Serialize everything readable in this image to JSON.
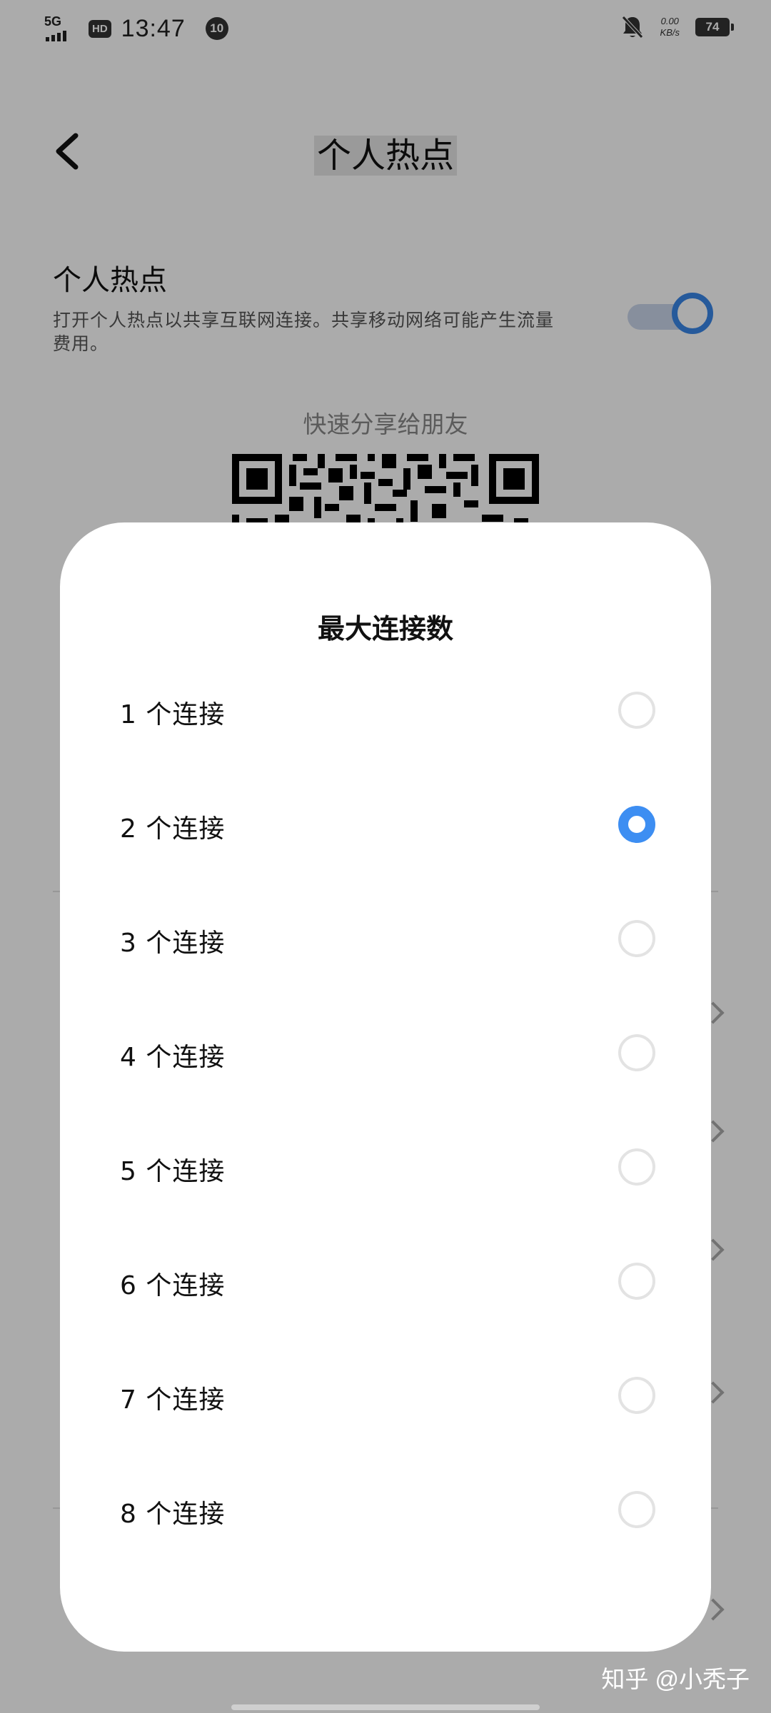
{
  "status_bar": {
    "network": "5G",
    "hd": "HD",
    "time": "13:47",
    "notification_count": "10",
    "speed_value": "0.00",
    "speed_unit": "KB/s",
    "battery": "74"
  },
  "header": {
    "title": "个人热点"
  },
  "hotspot": {
    "title": "个人热点",
    "description": "打开个人热点以共享互联网连接。共享移动网络可能产生流量费用。",
    "enabled": true
  },
  "share": {
    "label": "快速分享给朋友"
  },
  "dialog": {
    "title": "最大连接数",
    "selected_index": 1,
    "options": [
      {
        "label": "1 个连接"
      },
      {
        "label": "2 个连接"
      },
      {
        "label": "3 个连接"
      },
      {
        "label": "4 个连接"
      },
      {
        "label": "5 个连接"
      },
      {
        "label": "6 个连接"
      },
      {
        "label": "7 个连接"
      },
      {
        "label": "8 个连接"
      }
    ]
  },
  "colors": {
    "accent": "#3d8ef2",
    "overlay": "rgba(0,0,0,0.33)"
  },
  "watermark": "知乎 @小秃子"
}
